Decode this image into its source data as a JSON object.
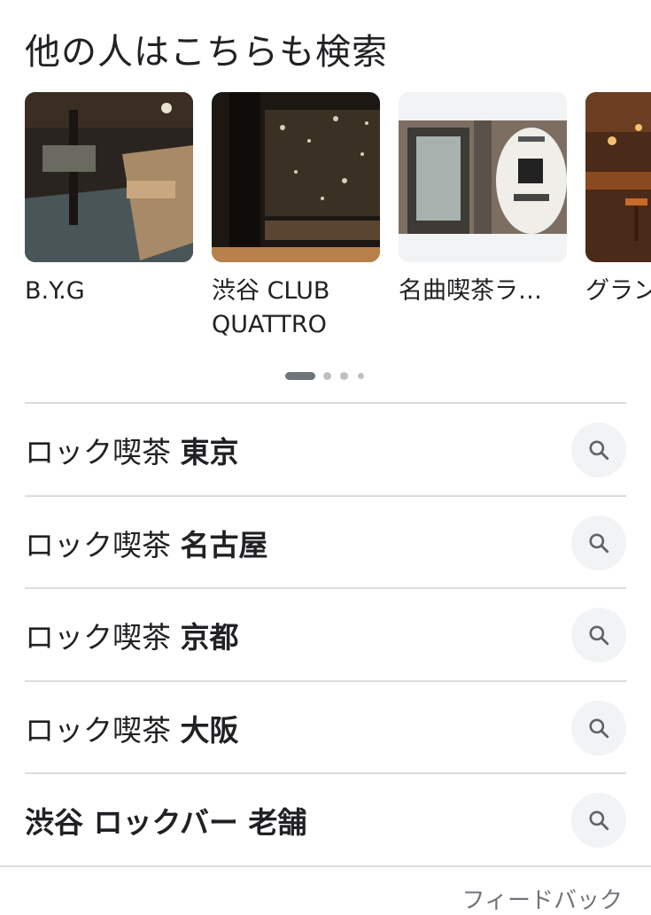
{
  "section_title": "他の人はこちらも検索",
  "places": [
    {
      "name": "B.Y.G"
    },
    {
      "name_line1": "渋谷 CLUB",
      "name_line2": "QUATTRO"
    },
    {
      "name": "名曲喫茶ラ…"
    },
    {
      "name": "グラン"
    }
  ],
  "carousel_dots": {
    "count": 4,
    "active_index": 0
  },
  "related_searches": [
    {
      "prefix": "ロック喫茶 ",
      "bold": "東京",
      "icon": "search-icon"
    },
    {
      "prefix": "ロック喫茶 ",
      "bold": "名古屋",
      "icon": "search-icon"
    },
    {
      "prefix": "ロック喫茶 ",
      "bold": "京都",
      "icon": "search-icon"
    },
    {
      "prefix": "ロック喫茶 ",
      "bold": "大阪",
      "icon": "search-icon"
    },
    {
      "prefix": "",
      "bold": "渋谷 ロックバー 老舗",
      "icon": "search-icon"
    }
  ],
  "feedback_label": "フィードバック",
  "colors": {
    "text": "#202124",
    "secondary": "#70757a",
    "divider": "#dadce0",
    "chip_bg": "#f1f3f4"
  }
}
